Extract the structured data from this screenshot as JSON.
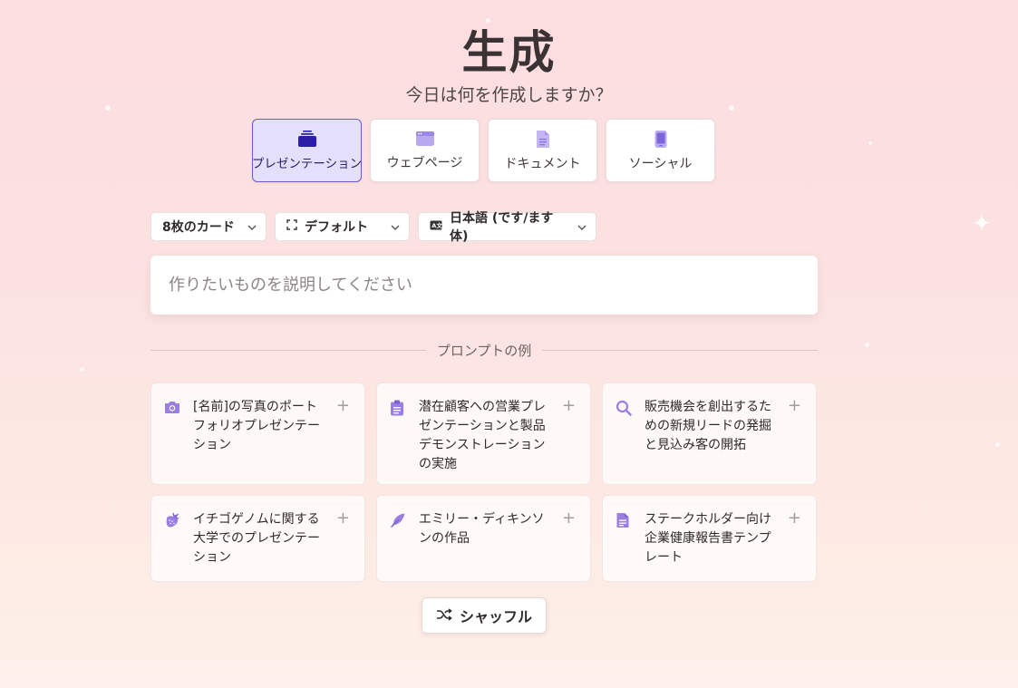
{
  "header": {
    "title": "生成",
    "subtitle": "今日は何を作成しますか？"
  },
  "types": [
    {
      "label": "プレゼンテーション",
      "icon": "presentation-icon",
      "active": true
    },
    {
      "label": "ウェブページ",
      "icon": "webpage-icon",
      "active": false
    },
    {
      "label": "ドキュメント",
      "icon": "document-icon",
      "active": false
    },
    {
      "label": "ソーシャル",
      "icon": "mobile-icon",
      "active": false
    }
  ],
  "options": {
    "cards": "8枚のカード",
    "theme": "デフォルト",
    "language": "日本語 (です/ます体)"
  },
  "prompt": {
    "placeholder": "作りたいものを説明してください"
  },
  "examples": {
    "heading": "プロンプトの例",
    "items": [
      {
        "text": "[名前]の写真のポートフォリオプレゼンテーション",
        "icon": "camera-icon"
      },
      {
        "text": "潜在顧客への営業プレゼンテーションと製品デモンストレーションの実施",
        "icon": "clipboard-icon"
      },
      {
        "text": "販売機会を創出するための新規リードの発掘と見込み客の開拓",
        "icon": "search-icon"
      },
      {
        "text": "イチゴゲノムに関する大学でのプレゼンテーション",
        "icon": "strawberry-icon"
      },
      {
        "text": "エミリー・ディキンソンの作品",
        "icon": "feather-icon"
      },
      {
        "text": "ステークホルダー向け企業健康報告書テンプレート",
        "icon": "document-icon"
      }
    ]
  },
  "shuffle_label": "シャッフル",
  "colors": {
    "accent": "#6b5cc8",
    "icon_purple": "#9b7fe0",
    "active_bg": "#e4e0fb"
  }
}
